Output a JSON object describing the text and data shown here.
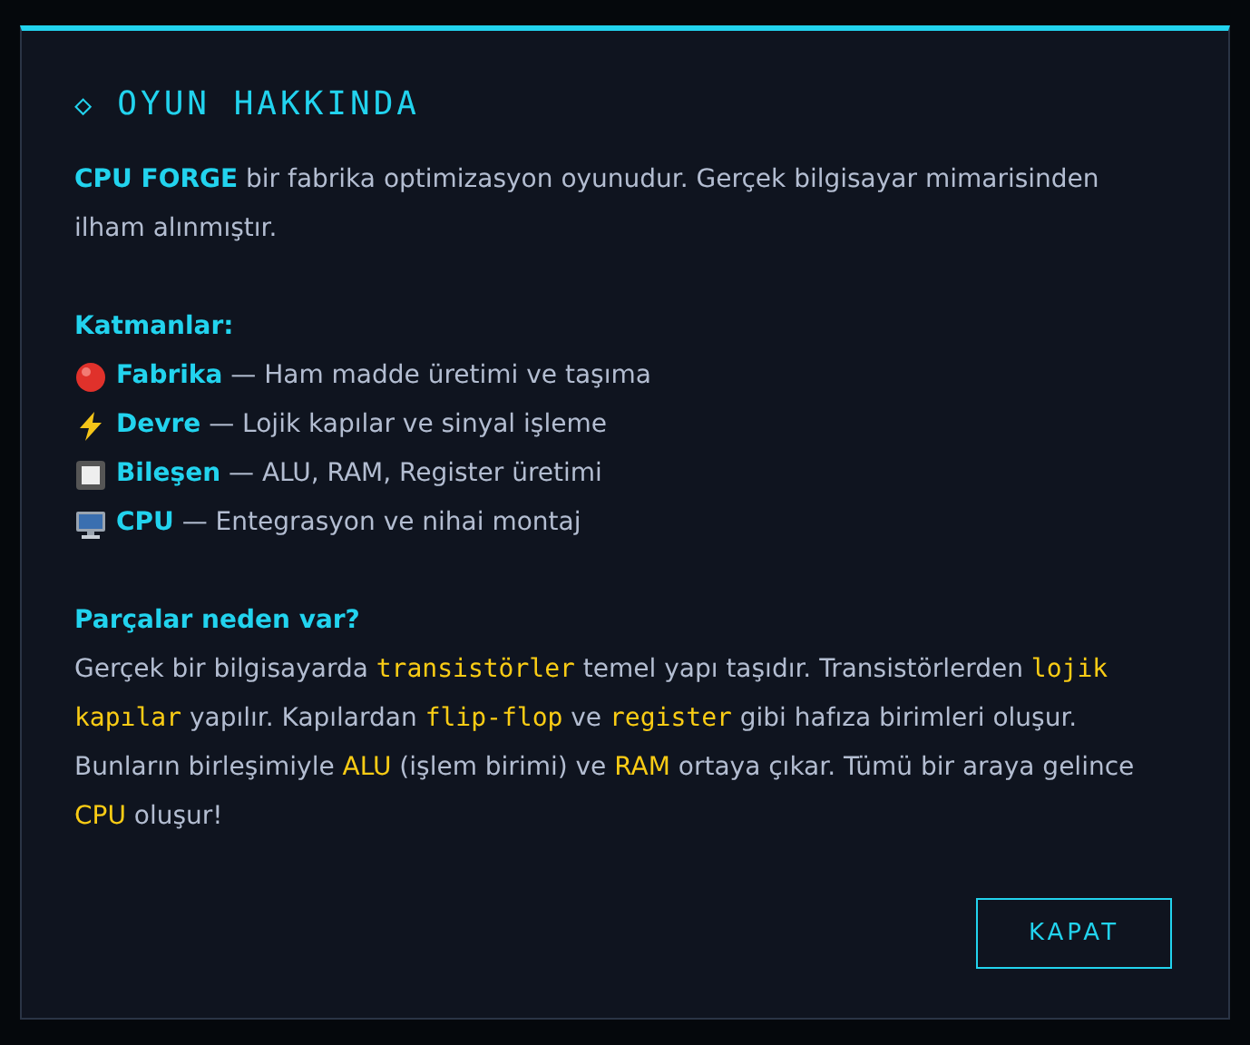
{
  "dialog": {
    "title_icon": "◇",
    "title": "OYUN HAKKINDA",
    "intro": "**CPU FORGE** bir fabrika optimizasyon oyunudur. Gerçek bilgisayar mimarisinden ilham alınmıştır.",
    "layers_heading": "Katmanlar:",
    "layers": [
      {
        "name": "Fabrika",
        "description": "— Ham madde üretimi ve taşıma"
      },
      {
        "name": "Devre",
        "description": "— Lojik kapılar ve sinyal işleme"
      },
      {
        "name": "Bileşen",
        "description": "— ALU, RAM, Register üretimi"
      },
      {
        "name": "CPU",
        "description": "— Entegrasyon ve nihai montaj"
      }
    ],
    "parts_heading": "Parçalar neden var?",
    "parts_text": [
      {
        "kind": "plain",
        "text": "Gerçek bir bilgisayarda "
      },
      {
        "kind": "code",
        "text": "transistörler"
      },
      {
        "kind": "plain",
        "text": " temel yapı taşıdır. Transistörlerden "
      },
      {
        "kind": "code",
        "text": "lojik kapılar"
      },
      {
        "kind": "plain",
        "text": " yapılır. Kapılardan "
      },
      {
        "kind": "code",
        "text": "flip-flop"
      },
      {
        "kind": "plain",
        "text": " ve "
      },
      {
        "kind": "code",
        "text": "register"
      },
      {
        "kind": "plain",
        "text": " gibi hafıza birimleri oluşur. Bunların birleşimiyle "
      },
      {
        "kind": "accent",
        "text": "ALU"
      },
      {
        "kind": "plain",
        "text": " (işlem birimi) ve "
      },
      {
        "kind": "accent",
        "text": "RAM"
      },
      {
        "kind": "plain",
        "text": " ortaya çıkar. Tümü bir araya gelince "
      },
      {
        "kind": "accent",
        "text": "CPU"
      },
      {
        "kind": "plain",
        "text": " oluşur!"
      }
    ],
    "close_button": "KAPAT"
  }
}
